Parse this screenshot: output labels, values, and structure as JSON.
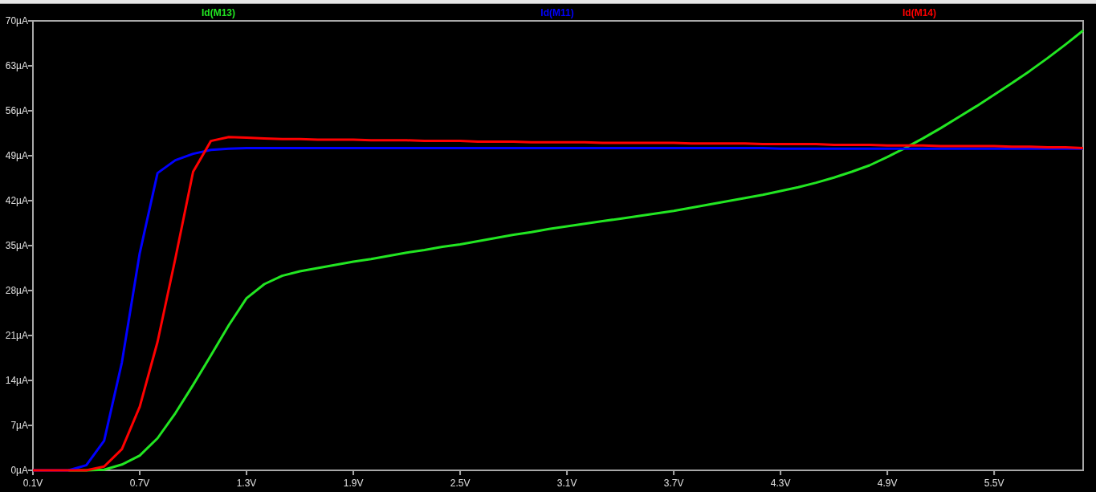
{
  "chart_data": {
    "type": "line",
    "x": [
      0.1,
      0.2,
      0.3,
      0.4,
      0.5,
      0.6,
      0.7,
      0.8,
      0.9,
      1.0,
      1.1,
      1.2,
      1.3,
      1.4,
      1.5,
      1.6,
      1.7,
      1.8,
      1.9,
      2.0,
      2.1,
      2.2,
      2.3,
      2.4,
      2.5,
      2.6,
      2.7,
      2.8,
      2.9,
      3.0,
      3.1,
      3.2,
      3.3,
      3.4,
      3.5,
      3.6,
      3.7,
      3.8,
      3.9,
      4.0,
      4.1,
      4.2,
      4.3,
      4.4,
      4.5,
      4.6,
      4.7,
      4.8,
      4.9,
      5.0,
      5.1,
      5.2,
      5.3,
      5.4,
      5.5,
      5.6,
      5.7,
      5.8,
      5.9,
      6.0
    ],
    "series": [
      {
        "name": "Id(M13)",
        "color": "#22e622",
        "values": [
          null,
          null,
          0,
          0,
          0.1,
          0.9,
          2.3,
          5,
          8.9,
          13.3,
          17.9,
          22.6,
          26.8,
          29,
          30.3,
          31,
          31.5,
          32,
          32.5,
          32.9,
          33.4,
          33.9,
          34.3,
          34.8,
          35.2,
          35.7,
          36.2,
          36.7,
          37.1,
          37.6,
          38.0,
          38.4,
          38.8,
          39.2,
          39.6,
          40.0,
          40.4,
          40.9,
          41.4,
          41.9,
          42.4,
          42.9,
          43.5,
          44.1,
          44.8,
          45.6,
          46.5,
          47.5,
          48.8,
          50.2,
          51.7,
          53.3,
          55.0,
          56.7,
          58.5,
          60.3,
          62.2,
          64.2,
          66.3,
          68.5
        ]
      },
      {
        "name": "Id(M11)",
        "color": "#0000ff",
        "values": [
          0,
          0,
          0,
          0.8,
          4.6,
          16.8,
          33.8,
          46.3,
          48.3,
          49.3,
          49.9,
          50.1,
          50.2,
          50.2,
          50.2,
          50.2,
          50.2,
          50.2,
          50.2,
          50.2,
          50.2,
          50.2,
          50.2,
          50.2,
          50.2,
          50.2,
          50.2,
          50.2,
          50.2,
          50.2,
          50.2,
          50.2,
          50.2,
          50.2,
          50.2,
          50.2,
          50.2,
          50.2,
          50.2,
          50.2,
          50.2,
          50.2,
          50.1,
          50.1,
          50.1,
          50.1,
          50.1,
          50.1,
          50.1,
          50.1,
          50.1,
          50.1,
          50.1,
          50.1,
          50.1,
          50.1,
          50.1,
          50.1,
          50.1,
          50.1
        ]
      },
      {
        "name": "Id(M14)",
        "color": "#ff0000",
        "values": [
          0,
          0,
          0,
          0,
          0.6,
          3.3,
          9.9,
          20,
          33,
          46.5,
          51.3,
          51.9,
          51.8,
          51.7,
          51.6,
          51.6,
          51.5,
          51.5,
          51.5,
          51.4,
          51.4,
          51.4,
          51.3,
          51.3,
          51.3,
          51.2,
          51.2,
          51.2,
          51.1,
          51.1,
          51.1,
          51.1,
          51.0,
          51.0,
          51.0,
          51.0,
          51.0,
          50.9,
          50.9,
          50.9,
          50.9,
          50.8,
          50.8,
          50.8,
          50.8,
          50.7,
          50.7,
          50.7,
          50.6,
          50.6,
          50.6,
          50.5,
          50.5,
          50.5,
          50.5,
          50.4,
          50.4,
          50.3,
          50.3,
          50.2
        ]
      }
    ],
    "xlim": [
      0.1,
      6.0
    ],
    "ylim": [
      0,
      70
    ],
    "xticks": [
      {
        "value": 0.1,
        "label": "0.1V"
      },
      {
        "value": 0.7,
        "label": "0.7V"
      },
      {
        "value": 1.3,
        "label": "1.3V"
      },
      {
        "value": 1.9,
        "label": "1.9V"
      },
      {
        "value": 2.5,
        "label": "2.5V"
      },
      {
        "value": 3.1,
        "label": "3.1V"
      },
      {
        "value": 3.7,
        "label": "3.7V"
      },
      {
        "value": 4.3,
        "label": "4.3V"
      },
      {
        "value": 4.9,
        "label": "4.9V"
      },
      {
        "value": 5.5,
        "label": "5.5V"
      }
    ],
    "yticks": [
      {
        "value": 0,
        "label": "0µA"
      },
      {
        "value": 7,
        "label": "7µA"
      },
      {
        "value": 14,
        "label": "14µA"
      },
      {
        "value": 21,
        "label": "21µA"
      },
      {
        "value": 28,
        "label": "28µA"
      },
      {
        "value": 35,
        "label": "35µA"
      },
      {
        "value": 42,
        "label": "42µA"
      },
      {
        "value": 49,
        "label": "49µA"
      },
      {
        "value": 56,
        "label": "56µA"
      },
      {
        "value": 63,
        "label": "63µA"
      },
      {
        "value": 70,
        "label": "70µA"
      }
    ]
  }
}
